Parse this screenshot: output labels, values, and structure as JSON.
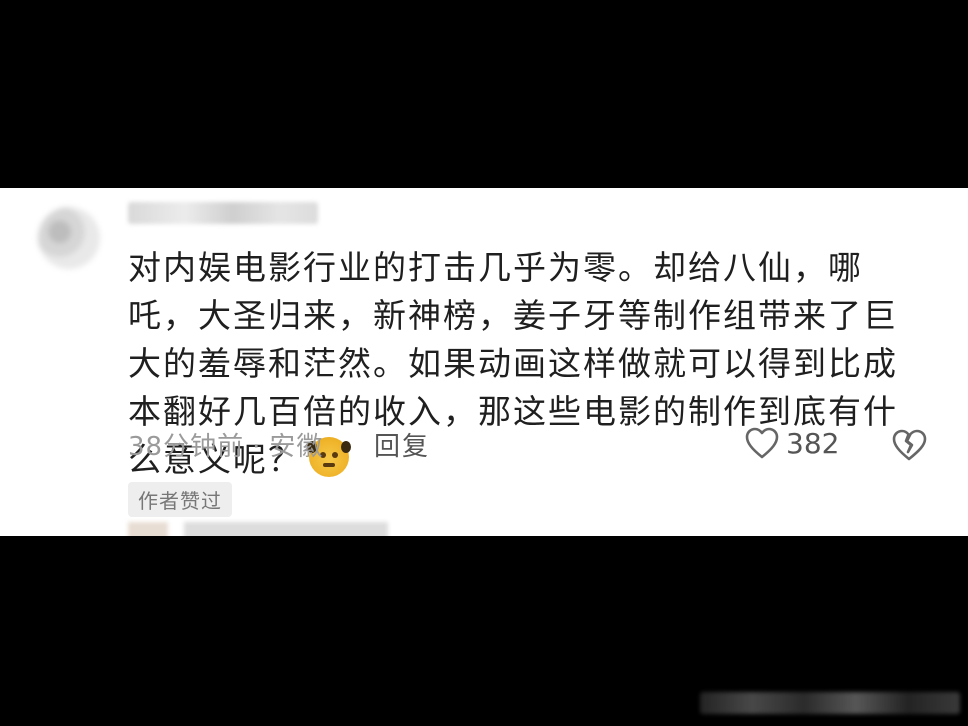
{
  "comment": {
    "text": "对内娱电影行业的打击几乎为零。却给八仙，哪吒，大圣归来，新神榜，姜子牙等制作组带来了巨大的羞辱和茫然。如果动画这样做就可以得到比成本翻好几百倍的收入，那这些电影的制作到底有什么意义呢？",
    "emoji_icon": "sad-face-emoji-icon"
  },
  "meta": {
    "time": "38分钟前",
    "separator": "·",
    "location": "安徽",
    "reply_label": "回复",
    "like_count": "382",
    "badge": "作者赞过"
  },
  "colors": {
    "card_bg": "#ffffff",
    "page_bg": "#000000",
    "text": "#1f1f1f",
    "meta": "#9a9a9a"
  }
}
